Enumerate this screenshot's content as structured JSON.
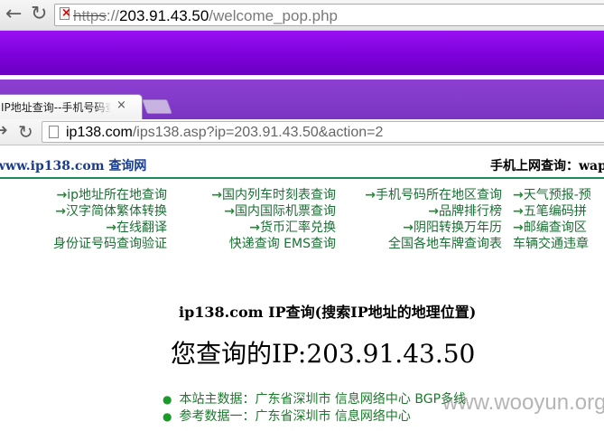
{
  "outer_browser": {
    "url_scheme": "https",
    "url_sep": "://",
    "url_host": "203.91.43.50",
    "url_path": "/welcome_pop.php",
    "security_warning_glyph": "×"
  },
  "inner_browser": {
    "tab_title": "IP地址查询--手机号码查询",
    "tab_close": "×",
    "url_host": "ip138.com",
    "url_path": "/ips138.asp?ip=203.91.43.50&action=2"
  },
  "site_header": {
    "brand": "www.ip138.com 查询网",
    "mobile_query": "手机上网查询：wap"
  },
  "link_grid": {
    "arrow": "→",
    "rows": [
      [
        {
          "arrow": true,
          "text": "ip地址所在地查询"
        },
        {
          "arrow": true,
          "text": "国内列车时刻表查询"
        },
        {
          "arrow": true,
          "text": "手机号码所在地区查询"
        },
        {
          "arrow": true,
          "text": "天气预报-预"
        }
      ],
      [
        {
          "arrow": true,
          "text": "汉字简体繁体转换"
        },
        {
          "arrow": true,
          "text": "国内国际机票查询"
        },
        {
          "arrow": true,
          "text": "品牌排行榜"
        },
        {
          "arrow": true,
          "text": "五笔编码拼"
        }
      ],
      [
        {
          "arrow": true,
          "text": "在线翻译"
        },
        {
          "arrow": true,
          "text": "货币汇率兑换"
        },
        {
          "arrow": true,
          "text": "阴阳转换万年历"
        },
        {
          "arrow": true,
          "text": "邮编查询区"
        }
      ],
      [
        {
          "arrow": false,
          "text": "身份证号码查询验证"
        },
        {
          "arrow": false,
          "text": "快递查询 EMS查询"
        },
        {
          "arrow": false,
          "text": "全国各地车牌查询表"
        },
        {
          "arrow": false,
          "text": "车辆交通违章"
        }
      ]
    ]
  },
  "result": {
    "title": "ip138.com IP查询(搜索IP地址的地理位置)",
    "ip_line": "您查询的IP:203.91.43.50",
    "items": [
      "本站主数据：广东省深圳市 信息网络中心 BGP多线",
      "参考数据一：广东省深圳市 信息网络中心"
    ],
    "bullet": "●"
  },
  "watermark": "www.wooyun.org",
  "icons": {
    "back": "arrow-left-icon",
    "forward": "arrow-right-icon",
    "reload": "reload-icon",
    "page": "page-icon",
    "security": "broken-lock-icon"
  },
  "colors": {
    "purple_band": "#7d00db",
    "link_green": "#1a6f33",
    "brand_blue": "#1a3c8c"
  }
}
